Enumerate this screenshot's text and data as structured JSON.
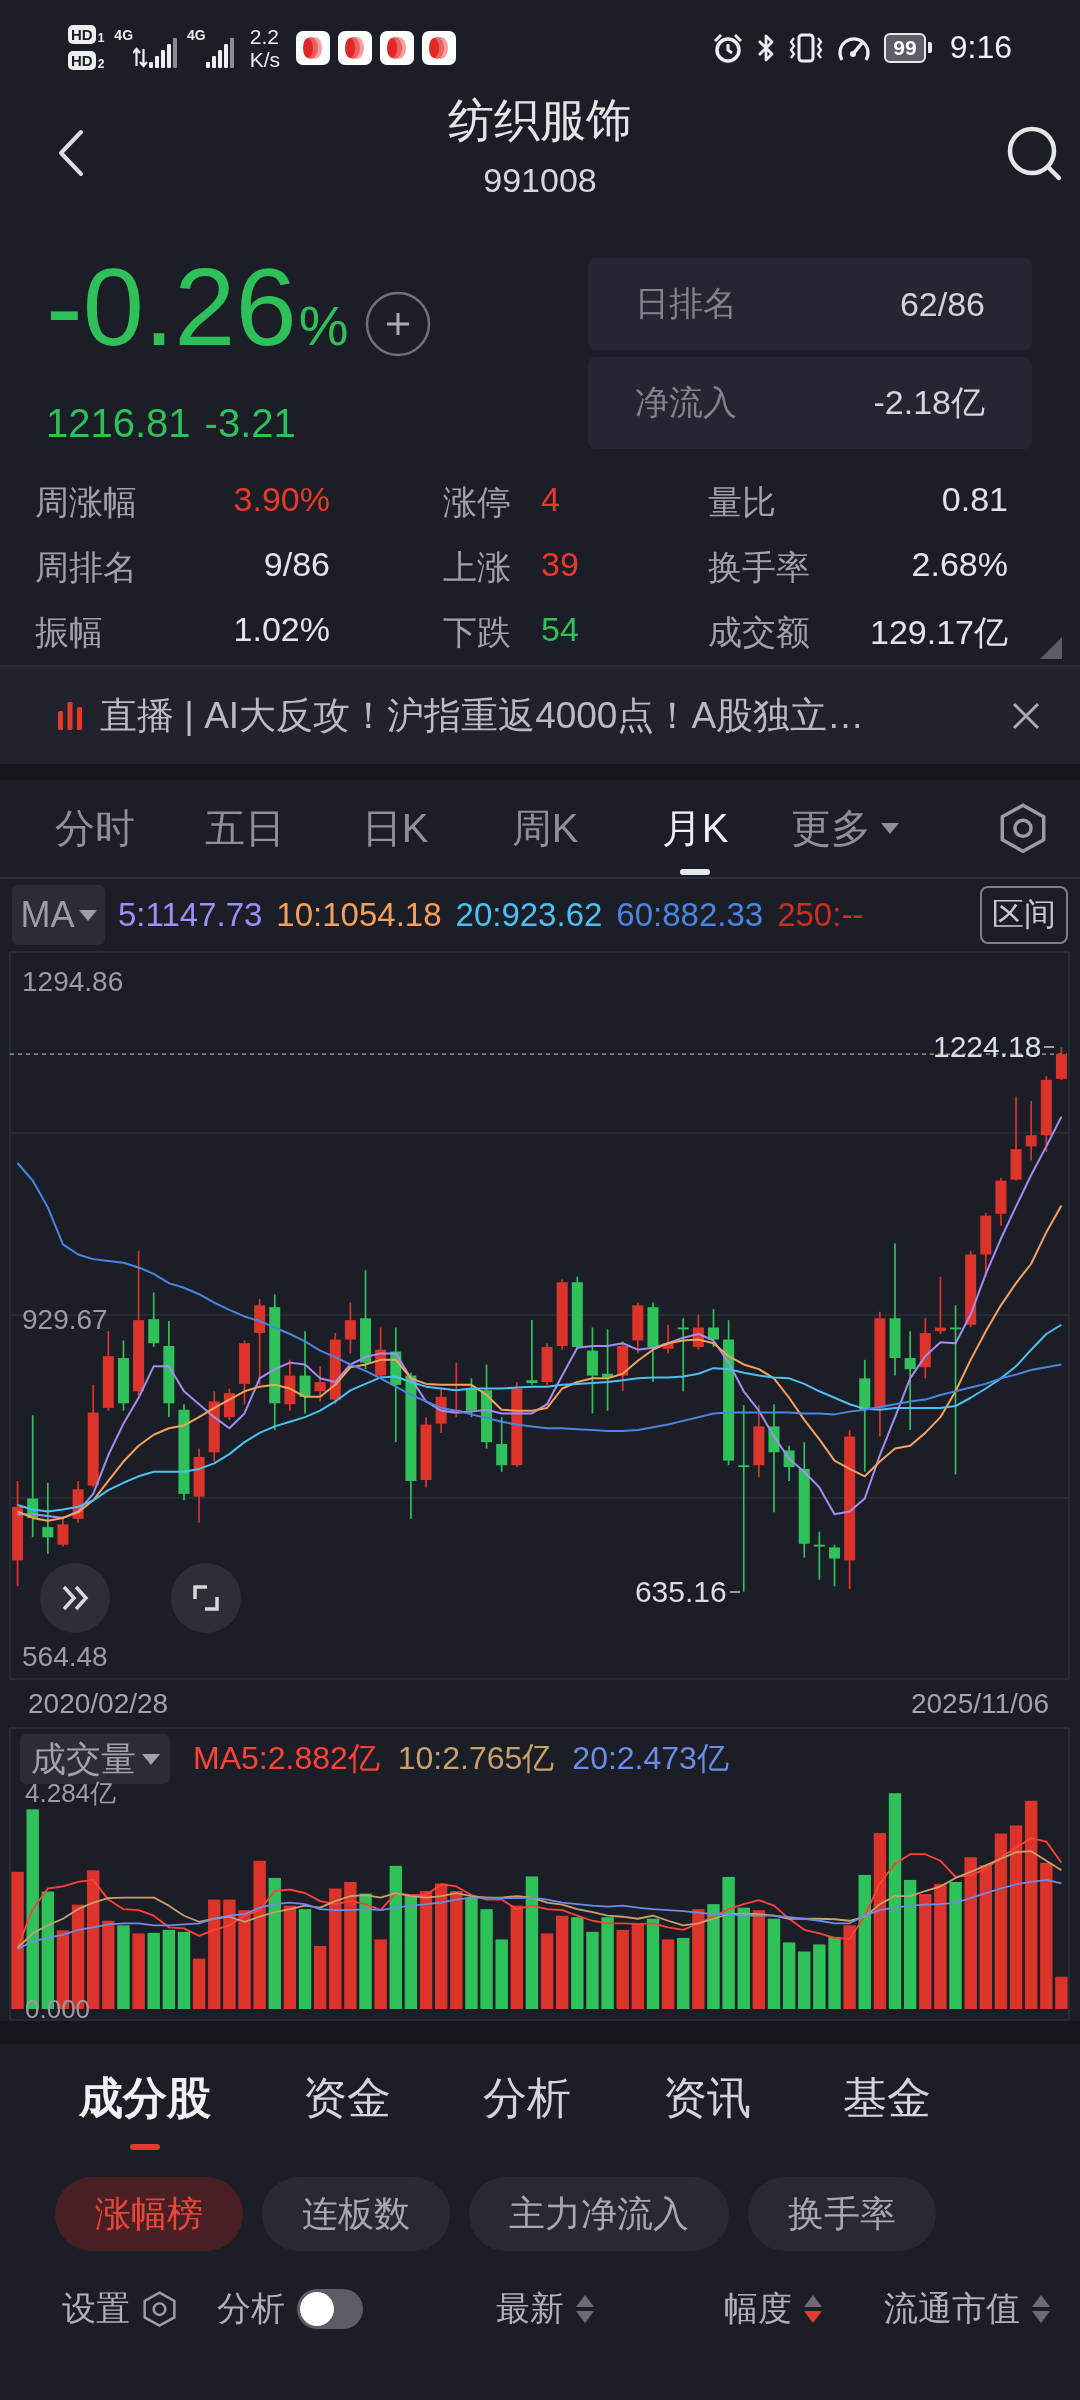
{
  "status_bar": {
    "sims": [
      {
        "badge": "HD",
        "slot": "1",
        "network": "4G",
        "data_active": true
      },
      {
        "badge": "HD",
        "slot": "2",
        "network": "4G",
        "data_active": false
      }
    ],
    "speed": "2.2",
    "speed_unit": "K/s",
    "battery": "99",
    "time": "9:16"
  },
  "header": {
    "title": "纺织服饰",
    "code": "991008"
  },
  "quote": {
    "change_percent": "-0.26",
    "percent_sign": "%",
    "price": "1216.81",
    "change": "-3.21",
    "falling": true
  },
  "rank_cards": [
    {
      "label": "日排名",
      "value": "62/86"
    },
    {
      "label": "净流入",
      "value": "-2.18亿"
    }
  ],
  "stats": [
    {
      "label": "周涨幅",
      "value": "3.90%",
      "color": "#e8392c"
    },
    {
      "label": "涨停",
      "value": "4",
      "color": "#e8392c"
    },
    {
      "label": "量比",
      "value": "0.81",
      "color": "#e2e4e8"
    },
    {
      "label": "周排名",
      "value": "9/86",
      "color": "#e2e4e8"
    },
    {
      "label": "上涨",
      "value": "39",
      "color": "#e8392c"
    },
    {
      "label": "换手率",
      "value": "2.68%",
      "color": "#e2e4e8"
    },
    {
      "label": "振幅",
      "value": "1.02%",
      "color": "#e2e4e8"
    },
    {
      "label": "下跌",
      "value": "54",
      "color": "#2ec15a"
    },
    {
      "label": "成交额",
      "value": "129.17亿",
      "color": "#e2e4e8"
    }
  ],
  "news_ticker": {
    "text": "直播 | AI大反攻！沪指重返4000点！A股独立…"
  },
  "chart_tabs": [
    {
      "label": "分时",
      "selected": false,
      "kind": "tab"
    },
    {
      "label": "五日",
      "selected": false,
      "kind": "tab"
    },
    {
      "label": "日K",
      "selected": false,
      "kind": "tab"
    },
    {
      "label": "周K",
      "selected": false,
      "kind": "tab"
    },
    {
      "label": "月K",
      "selected": true,
      "kind": "tab"
    },
    {
      "label": "更多",
      "selected": false,
      "kind": "dropdown"
    }
  ],
  "ma_legend": {
    "selector": "MA",
    "range_button": "区间"
  },
  "price_chart": {
    "chart_data": {
      "type": "candlestick",
      "categories": [
        null,
        null,
        null,
        null,
        null,
        null,
        null,
        null,
        null,
        null,
        null,
        null,
        null,
        null,
        null,
        null,
        null,
        null,
        null,
        null,
        null,
        null,
        null,
        null,
        null,
        null,
        null,
        null,
        null,
        null,
        null,
        null,
        null,
        null,
        null,
        null,
        null,
        null,
        null,
        null,
        null,
        null,
        null,
        null,
        null,
        null,
        null,
        null,
        null,
        null,
        null,
        null,
        null,
        null,
        null,
        null,
        null,
        null,
        null,
        null,
        null,
        null,
        null,
        null,
        null,
        null,
        null,
        null,
        null,
        null
      ],
      "ohlc": [
        [
          669,
          755,
          641,
          727
        ],
        [
          736,
          826,
          694,
          715
        ],
        [
          705,
          753,
          676,
          694
        ],
        [
          686,
          717,
          684,
          708
        ],
        [
          714,
          755,
          710,
          746
        ],
        [
          750,
          859,
          748,
          829
        ],
        [
          834,
          917,
          831,
          890
        ],
        [
          888,
          907,
          831,
          839
        ],
        [
          852,
          1004,
          848,
          929
        ],
        [
          930,
          959,
          900,
          904
        ],
        [
          901,
          928,
          824,
          839
        ],
        [
          832,
          838,
          734,
          741
        ],
        [
          738,
          790,
          710,
          781
        ],
        [
          786,
          852,
          776,
          841
        ],
        [
          824,
          855,
          821,
          850
        ],
        [
          860,
          907,
          838,
          904
        ],
        [
          915,
          952,
          859,
          945
        ],
        [
          943,
          957,
          810,
          839
        ],
        [
          838,
          886,
          831,
          869
        ],
        [
          869,
          917,
          828,
          846
        ],
        [
          852,
          879,
          841,
          862
        ],
        [
          843,
          915,
          838,
          908
        ],
        [
          908,
          948,
          893,
          929
        ],
        [
          931,
          983,
          876,
          883
        ],
        [
          869,
          921,
          866,
          897
        ],
        [
          895,
          921,
          797,
          859
        ],
        [
          869,
          872,
          714,
          755
        ],
        [
          756,
          824,
          748,
          816
        ],
        [
          817,
          855,
          807,
          846
        ],
        [
          828,
          883,
          824,
          832
        ],
        [
          855,
          866,
          824,
          831
        ],
        [
          853,
          881,
          790,
          797
        ],
        [
          795,
          824,
          765,
          772
        ],
        [
          772,
          862,
          770,
          855
        ],
        [
          864,
          929,
          859,
          861
        ],
        [
          862,
          904,
          859,
          900
        ],
        [
          901,
          973,
          897,
          970
        ],
        [
          970,
          976,
          897,
          900
        ],
        [
          896,
          921,
          828,
          869
        ],
        [
          871,
          919,
          831,
          867
        ],
        [
          869,
          906,
          852,
          901
        ],
        [
          907,
          948,
          893,
          945
        ],
        [
          943,
          948,
          862,
          900
        ],
        [
          898,
          924,
          893,
          904
        ],
        [
          921,
          931,
          852,
          919
        ],
        [
          900,
          935,
          897,
          921
        ],
        [
          921,
          941,
          900,
          908
        ],
        [
          908,
          929,
          772,
          777
        ],
        [
          772,
          837,
          635.16,
          770
        ],
        [
          772,
          837,
          759,
          814
        ],
        [
          814,
          838,
          721,
          786
        ],
        [
          788,
          793,
          755,
          770
        ],
        [
          768,
          797,
          672,
          687
        ],
        [
          686,
          700,
          648,
          684
        ],
        [
          683,
          686,
          641,
          671
        ],
        [
          669,
          810,
          638,
          803
        ],
        [
          866,
          886,
          765,
          832
        ],
        [
          834,
          938,
          803,
          931
        ],
        [
          931,
          1012,
          869,
          888
        ],
        [
          888,
          917,
          810,
          876
        ],
        [
          878,
          931,
          866,
          915
        ],
        [
          917,
          976,
          914,
          921
        ],
        [
          921,
          945,
          762,
          919
        ],
        [
          924,
          1004,
          921,
          1000
        ],
        [
          1000,
          1045,
          976,
          1042
        ],
        [
          1044,
          1083,
          1031,
          1080
        ],
        [
          1081,
          1171,
          1080,
          1114
        ],
        [
          1117,
          1166,
          1102,
          1129
        ],
        [
          1129,
          1193,
          1111,
          1189
        ],
        [
          1190,
          1224.18,
          1189,
          1216.81
        ]
      ],
      "ylim": [
        539.6,
        1328.4
      ],
      "yticks": [
        1294.86,
        929.67,
        564.48
      ],
      "ref_lines": [
        {
          "axis": "y",
          "value": 1216.81
        }
      ],
      "series": [
        {
          "name": "5:1147.73",
          "type": "line",
          "color": "#a38cf2",
          "values": [
            719,
            719,
            717,
            715,
            722,
            741,
            783,
            817,
            845,
            879,
            879,
            852,
            838,
            824,
            812,
            828,
            866,
            876,
            883,
            881,
            866,
            862,
            881,
            889,
            893,
            893,
            866,
            841,
            831,
            829,
            830,
            832,
            828,
            828,
            828,
            838,
            869,
            899,
            901,
            901,
            904,
            897,
            899,
            904,
            910,
            914,
            907,
            883,
            852,
            831,
            803,
            779,
            765,
            748,
            719,
            722,
            736,
            783,
            824,
            866,
            890,
            905,
            904,
            935,
            979,
            1017,
            1052,
            1086,
            1117,
            1149
          ]
        },
        {
          "name": "10:1054.18",
          "type": "line",
          "color": "#f5a15c",
          "values": [
            722,
            715,
            712,
            715,
            721,
            734,
            755,
            776,
            793,
            805,
            812,
            815,
            824,
            834,
            843,
            852,
            857,
            859,
            855,
            846,
            846,
            859,
            878,
            881,
            886,
            886,
            866,
            860,
            859,
            859,
            859,
            848,
            832,
            831,
            831,
            834,
            855,
            862,
            866,
            866,
            871,
            885,
            897,
            904,
            907,
            908,
            904,
            890,
            881,
            876,
            866,
            845,
            821,
            800,
            777,
            768,
            760,
            776,
            790,
            793,
            807,
            824,
            852,
            886,
            917,
            945,
            969,
            990,
            1024,
            1053
          ]
        },
        {
          "name": "20:923.62",
          "type": "line",
          "color": "#4cc0f2",
          "values": [
            729,
            724,
            722,
            724,
            727,
            734,
            745,
            753,
            760,
            765,
            765,
            765,
            768,
            774,
            784,
            797,
            807,
            814,
            819,
            824,
            831,
            841,
            853,
            860,
            867,
            868,
            862,
            857,
            855,
            853,
            855,
            855,
            855,
            856,
            857,
            857,
            859,
            860,
            861,
            862,
            864,
            866,
            867,
            867,
            868,
            871,
            877,
            876,
            872,
            869,
            867,
            866,
            860,
            852,
            845,
            838,
            833,
            832,
            834,
            834,
            834,
            834,
            836,
            845,
            855,
            866,
            879,
            897,
            914,
            924
          ]
        },
        {
          "name": "60:882.33",
          "type": "line",
          "color": "#4a86e0",
          "values": [
            1099,
            1080,
            1051,
            1011,
            1000,
            995,
            993,
            991,
            986,
            979,
            969,
            964,
            957,
            948,
            940,
            933,
            928,
            921,
            914,
            906,
            896,
            889,
            881,
            874,
            866,
            857,
            848,
            841,
            834,
            831,
            827,
            823,
            819,
            816,
            814,
            812,
            812,
            811,
            810,
            809,
            809,
            810,
            813,
            816,
            820,
            824,
            828,
            829,
            829,
            829,
            829,
            829,
            828,
            828,
            827,
            830,
            832,
            835,
            838,
            841,
            843,
            848,
            852,
            856,
            860,
            866,
            870,
            875,
            878,
            881
          ]
        },
        {
          "name": "250:--",
          "type": "line",
          "color": "#c9301f",
          "values": [
            null,
            null,
            null,
            null,
            null,
            null,
            null,
            null,
            null,
            null,
            null,
            null,
            null,
            null,
            null,
            null,
            null,
            null,
            null,
            null,
            null,
            null,
            null,
            null,
            null,
            null,
            null,
            null,
            null,
            null,
            null,
            null,
            null,
            null,
            null,
            null,
            null,
            null,
            null,
            null,
            null,
            null,
            null,
            null,
            null,
            null,
            null,
            null,
            null,
            null,
            null,
            null,
            null,
            null,
            null,
            null,
            null,
            null,
            null,
            null,
            null,
            null,
            null,
            null,
            null,
            null,
            null,
            null,
            null,
            null
          ]
        }
      ]
    },
    "high_label": "1224.18",
    "low_label": "635.16",
    "start_date": "2020/02/28",
    "end_date": "2025/11/06"
  },
  "volume_chart": {
    "chart_data": {
      "type": "bar",
      "categories": [
        null,
        null,
        null,
        null,
        null,
        null,
        null,
        null,
        null,
        null,
        null,
        null,
        null,
        null,
        null,
        null,
        null,
        null,
        null,
        null,
        null,
        null,
        null,
        null,
        null,
        null,
        null,
        null,
        null,
        null,
        null,
        null,
        null,
        null,
        null,
        null,
        null,
        null,
        null,
        null,
        null,
        null,
        null,
        null,
        null,
        null,
        null,
        null,
        null,
        null,
        null,
        null,
        null,
        null,
        null,
        null,
        null,
        null,
        null,
        null,
        null,
        null,
        null,
        null,
        null,
        null,
        null,
        null,
        null,
        null
      ],
      "ylim": [
        0,
        4.284
      ],
      "yticks": [
        {
          "value": 4.284,
          "label": "4.284亿"
        },
        {
          "value": 0,
          "label": "0.000"
        }
      ],
      "series": [
        {
          "name": "成交量",
          "colors": [
            "#dc342a",
            "#2fc25b",
            "#2fc25b",
            "#dc342a",
            "#dc342a",
            "#dc342a",
            "#dc342a",
            "#2fc25b",
            "#dc342a",
            "#2fc25b",
            "#2fc25b",
            "#2fc25b",
            "#dc342a",
            "#dc342a",
            "#dc342a",
            "#dc342a",
            "#dc342a",
            "#2fc25b",
            "#dc342a",
            "#2fc25b",
            "#dc342a",
            "#dc342a",
            "#dc342a",
            "#2fc25b",
            "#dc342a",
            "#2fc25b",
            "#2fc25b",
            "#dc342a",
            "#dc342a",
            "#dc342a",
            "#2fc25b",
            "#2fc25b",
            "#2fc25b",
            "#dc342a",
            "#2fc25b",
            "#dc342a",
            "#dc342a",
            "#2fc25b",
            "#2fc25b",
            "#2fc25b",
            "#dc342a",
            "#dc342a",
            "#2fc25b",
            "#dc342a",
            "#2fc25b",
            "#dc342a",
            "#2fc25b",
            "#2fc25b",
            "#2fc25b",
            "#dc342a",
            "#2fc25b",
            "#2fc25b",
            "#2fc25b",
            "#2fc25b",
            "#2fc25b",
            "#dc342a",
            "#2fc25b",
            "#dc342a",
            "#2fc25b",
            "#2fc25b",
            "#dc342a",
            "#dc342a",
            "#2fc25b",
            "#dc342a",
            "#dc342a",
            "#dc342a",
            "#dc342a",
            "#dc342a",
            "#dc342a",
            "#dc342a"
          ],
          "values": [
            2.72,
            3.96,
            2.33,
            1.56,
            2.07,
            2.75,
            1.75,
            1.66,
            1.5,
            1.51,
            1.57,
            1.53,
            1.0,
            2.17,
            2.17,
            1.96,
            2.94,
            2.6,
            2.05,
            1.98,
            1.25,
            2.39,
            2.52,
            2.29,
            1.38,
            2.84,
            2.24,
            2.34,
            2.49,
            2.34,
            2.21,
            1.98,
            1.38,
            2.05,
            2.63,
            1.5,
            1.85,
            1.82,
            1.53,
            1.82,
            1.57,
            1.69,
            1.79,
            1.38,
            1.41,
            1.98,
            2.08,
            2.62,
            2.01,
            1.96,
            1.79,
            1.32,
            1.14,
            1.28,
            1.43,
            1.66,
            2.66,
            3.49,
            4.28,
            2.56,
            2.28,
            2.48,
            2.52,
            3.01,
            2.85,
            3.48,
            3.64,
            4.13,
            2.9,
            0.64
          ]
        },
        {
          "name": "MA5:2.882亿",
          "type": "line",
          "color": "#ff4136",
          "values": [
            1.21,
            1.98,
            2.39,
            2.43,
            2.52,
            2.56,
            2.17,
            1.98,
            1.96,
            1.85,
            1.62,
            1.6,
            1.45,
            1.57,
            1.66,
            1.85,
            1.96,
            2.34,
            2.37,
            2.3,
            2.14,
            2.08,
            2.14,
            2.08,
            1.96,
            2.3,
            2.26,
            2.26,
            2.47,
            2.43,
            2.26,
            2.17,
            2.17,
            1.98,
            2.05,
            1.98,
            1.96,
            1.85,
            1.75,
            1.7,
            1.7,
            1.69,
            1.7,
            1.62,
            1.57,
            1.7,
            1.83,
            1.98,
            2.08,
            2.16,
            2.05,
            1.79,
            1.57,
            1.5,
            1.41,
            1.39,
            1.85,
            2.49,
            2.88,
            3.07,
            3.07,
            2.94,
            2.62,
            2.65,
            2.78,
            3.01,
            3.2,
            3.39,
            3.32,
            2.9
          ]
        },
        {
          "name": "10:2.765亿",
          "type": "line",
          "color": "#c9a06c",
          "values": [
            1.21,
            1.5,
            1.66,
            1.79,
            1.98,
            2.11,
            2.2,
            2.21,
            2.21,
            2.21,
            2.05,
            1.85,
            1.73,
            1.79,
            1.83,
            1.73,
            1.83,
            1.92,
            1.98,
            2.05,
            2.01,
            2.14,
            2.24,
            2.26,
            2.21,
            2.3,
            2.24,
            2.21,
            2.24,
            2.3,
            2.24,
            2.21,
            2.21,
            2.24,
            2.21,
            2.11,
            2.07,
            1.98,
            1.92,
            1.85,
            1.83,
            1.79,
            1.85,
            1.75,
            1.66,
            1.7,
            1.79,
            1.88,
            1.89,
            1.88,
            1.85,
            1.79,
            1.79,
            1.79,
            1.78,
            1.75,
            1.83,
            2.08,
            2.24,
            2.24,
            2.34,
            2.43,
            2.6,
            2.72,
            2.85,
            2.98,
            3.11,
            3.13,
            2.94,
            2.75
          ]
        },
        {
          "name": "20:2.473亿",
          "type": "line",
          "color": "#6b8de8",
          "values": [
            1.19,
            1.34,
            1.41,
            1.47,
            1.57,
            1.62,
            1.68,
            1.7,
            1.7,
            1.66,
            1.66,
            1.68,
            1.7,
            1.79,
            1.85,
            1.88,
            2.01,
            2.08,
            2.11,
            2.08,
            1.98,
            1.96,
            1.96,
            1.98,
            1.96,
            2.01,
            2.05,
            2.08,
            2.11,
            2.17,
            2.21,
            2.21,
            2.2,
            2.2,
            2.21,
            2.17,
            2.11,
            2.08,
            2.05,
            2.03,
            2.05,
            2.01,
            1.98,
            1.96,
            1.94,
            1.91,
            1.88,
            1.88,
            1.85,
            1.85,
            1.85,
            1.82,
            1.79,
            1.75,
            1.7,
            1.7,
            1.85,
            1.96,
            2.01,
            2.05,
            2.07,
            2.08,
            2.11,
            2.2,
            2.3,
            2.39,
            2.47,
            2.52,
            2.56,
            2.49
          ]
        }
      ]
    }
  },
  "bottom_tabs": [
    {
      "label": "成分股",
      "selected": true
    },
    {
      "label": "资金",
      "selected": false
    },
    {
      "label": "分析",
      "selected": false
    },
    {
      "label": "资讯",
      "selected": false
    },
    {
      "label": "基金",
      "selected": false
    }
  ],
  "filter_chips": [
    {
      "label": "涨幅榜",
      "selected": true
    },
    {
      "label": "连板数",
      "selected": false
    },
    {
      "label": "主力净流入",
      "selected": false
    },
    {
      "label": "换手率",
      "selected": false
    }
  ],
  "sort_bar": {
    "settings_label": "设置",
    "analysis_label": "分析",
    "analysis_on": false,
    "columns": [
      {
        "label": "最新",
        "descending": false
      },
      {
        "label": "幅度",
        "descending": true
      },
      {
        "label": "流通市值",
        "descending": false
      }
    ]
  }
}
